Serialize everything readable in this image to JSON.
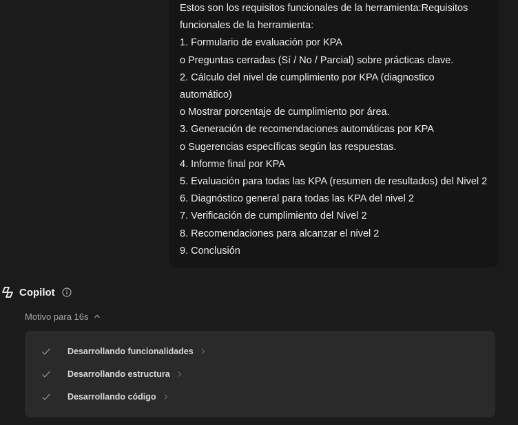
{
  "user_message": {
    "lines": [
      "Estos son los requisitos funcionales de la herramienta:Requisitos",
      "funcionales de la herramienta:",
      "1. Formulario de evaluación por KPA",
      "o Preguntas cerradas (Sí / No / Parcial) sobre prácticas clave.",
      "2. Cálculo del nivel de cumplimiento por KPA (diagnostico",
      "automático)",
      "o Mostrar porcentaje de cumplimiento por área.",
      "3. Generación de recomendaciones automáticas por KPA",
      "o Sugerencias específicas según las respuestas.",
      "4. Informe final por KPA",
      "5. Evaluación para todas las KPA (resumen de resultados) del Nivel 2",
      "6. Diagnóstico general para todas las KPA del nivel 2",
      "7. Verificación de cumplimiento del Nivel 2",
      "8. Recomendaciones para alcanzar el nivel 2",
      "9. Conclusión"
    ]
  },
  "assistant": {
    "name": "Copilot",
    "logo_icon": "copilot-logo-icon",
    "info_icon": "info-icon"
  },
  "reasoning": {
    "label": "Motivo para 16s",
    "expanded": true,
    "steps": [
      {
        "label": "Desarrollando funcionalidades",
        "status": "done"
      },
      {
        "label": "Desarrollando estructura",
        "status": "done"
      },
      {
        "label": "Desarrollando código",
        "status": "done"
      }
    ]
  },
  "colors": {
    "background": "#1b1b1b",
    "user_bubble": "#151515",
    "steps_panel": "#2a2a2a",
    "text_primary": "#ececec",
    "text_muted": "#a8a8a8"
  }
}
